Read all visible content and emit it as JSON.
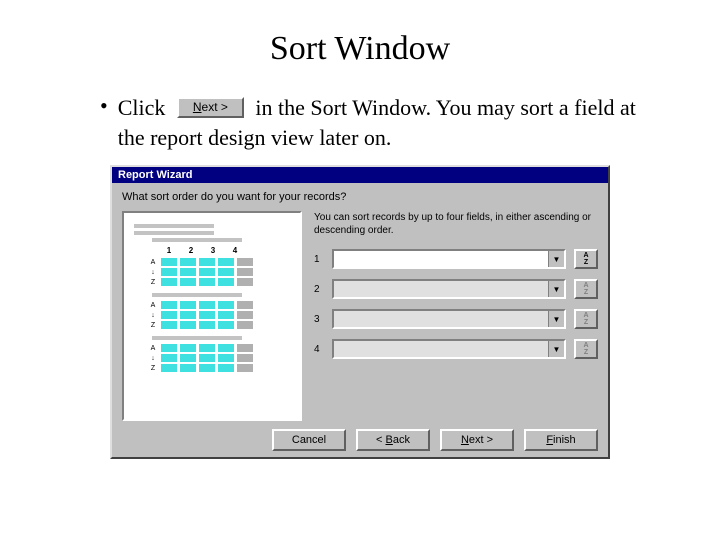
{
  "title": "Sort Window",
  "bullet": {
    "prefix": "Click",
    "button_label_underlined_char": "N",
    "button_label_rest": "ext >",
    "suffix": "in the Sort Window.  You may sort a field at the report design view later on."
  },
  "wizard": {
    "title": "Report Wizard",
    "question": "What sort order do you want for your records?",
    "intro": "You can sort records by up to four fields, in either ascending or descending order.",
    "preview_cols": [
      "1",
      "2",
      "3",
      "4"
    ],
    "preview_row_labs": [
      "A",
      "↓",
      "Z"
    ],
    "rows": [
      {
        "num": "1",
        "enabled": true
      },
      {
        "num": "2",
        "enabled": false
      },
      {
        "num": "3",
        "enabled": false
      },
      {
        "num": "4",
        "enabled": false
      }
    ],
    "buttons": {
      "cancel": "Cancel",
      "back": {
        "lt": "< ",
        "u": "B",
        "rest": "ack"
      },
      "next": {
        "u": "N",
        "rest": "ext >"
      },
      "finish": {
        "u": "F",
        "rest": "inish"
      }
    }
  }
}
